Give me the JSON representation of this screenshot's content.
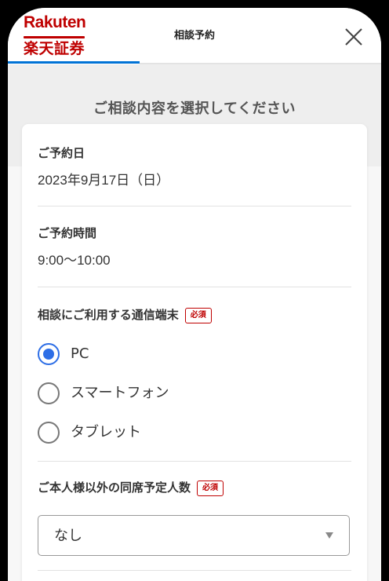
{
  "header": {
    "logo_top": "Rakuten",
    "logo_bottom": "楽天証券",
    "title": "相談予約"
  },
  "page_heading": "ご相談内容を選択してください",
  "reservation": {
    "date_label": "ご予約日",
    "date_value": "2023年9月17日（日）",
    "time_label": "ご予約時間",
    "time_value": "9:00〜10:00"
  },
  "device": {
    "label": "相談にご利用する通信端末",
    "required": "必須",
    "options": [
      {
        "label": "PC",
        "checked": true
      },
      {
        "label": "スマートフォン",
        "checked": false
      },
      {
        "label": "タブレット",
        "checked": false
      }
    ]
  },
  "companions": {
    "label": "ご本人様以外の同席予定人数",
    "required": "必須",
    "selected": "なし"
  },
  "colors": {
    "brand": "#bf0000",
    "accent": "#2d6ee6",
    "tab_indicator": "#0072d5"
  }
}
